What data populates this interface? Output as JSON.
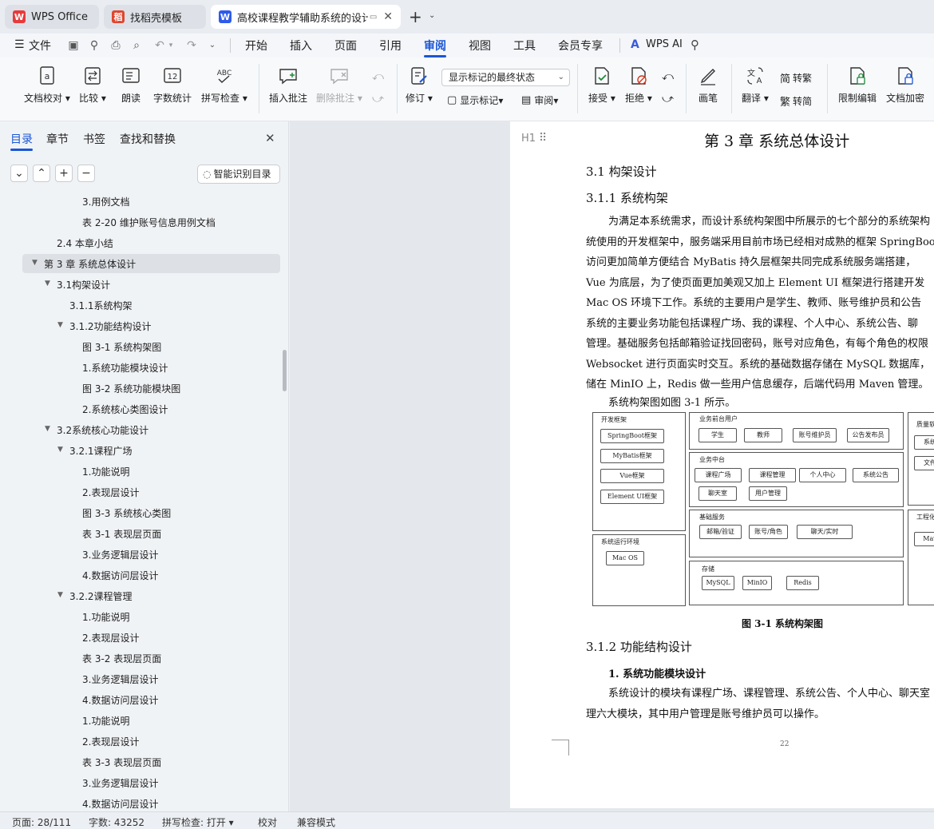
{
  "tabs": [
    {
      "label": "WPS Office",
      "icon": "wps-logo-icon",
      "color": "#e83b3b"
    },
    {
      "label": "找稻壳模板",
      "icon": "docer-icon",
      "color": "#e0462e"
    },
    {
      "label": "高校课程教学辅助系统的设计与",
      "icon": "word-doc-icon",
      "color": "#2f5bea"
    }
  ],
  "menubar": {
    "file": "文件",
    "items": [
      "开始",
      "插入",
      "页面",
      "引用",
      "审阅",
      "视图",
      "工具",
      "会员专享"
    ],
    "active": "审阅",
    "ai": "WPS AI"
  },
  "ribbon": {
    "doc_proof": "文档校对",
    "compare": "比较",
    "read_aloud": "朗读",
    "word_count": "字数统计",
    "spell_check": "拼写检查",
    "insert_comment": "插入批注",
    "delete_comment": "删除批注",
    "revise": "修订",
    "markup_select": "显示标记的最终状态",
    "show_markup": "显示标记",
    "review": "审阅",
    "accept": "接受",
    "reject": "拒绝",
    "pen": "画笔",
    "translate": "翻译",
    "to_traditional": "转繁",
    "to_simplified": "转简",
    "restrict_edit": "限制编辑",
    "doc_encrypt": "文档加密",
    "spell_icon_text": "ABC",
    "count_icon_text": "12"
  },
  "sidebar": {
    "tabs": [
      "目录",
      "章节",
      "书签",
      "查找和替换"
    ],
    "active_tab": "目录",
    "smart_toc": "智能识别目录",
    "toc": [
      {
        "label": "3.用例文档",
        "level": 4
      },
      {
        "label": "表 2-20 维护账号信息用例文档",
        "level": 4
      },
      {
        "label": "2.4 本章小结",
        "level": 2
      },
      {
        "label": "第 3 章 系统总体设计",
        "level": 1,
        "expanded": true,
        "selected": true
      },
      {
        "label": "3.1构架设计",
        "level": 2,
        "expanded": true
      },
      {
        "label": "3.1.1系统构架",
        "level": 3
      },
      {
        "label": "3.1.2功能结构设计",
        "level": 3,
        "expanded": true
      },
      {
        "label": "图 3-1 系统构架图",
        "level": 4
      },
      {
        "label": "1.系统功能模块设计",
        "level": 4
      },
      {
        "label": "图 3-2  系统功能模块图",
        "level": 4
      },
      {
        "label": "2.系统核心类图设计",
        "level": 4
      },
      {
        "label": "3.2系统核心功能设计",
        "level": 2,
        "expanded": true
      },
      {
        "label": "3.2.1课程广场",
        "level": 3,
        "expanded": true
      },
      {
        "label": "1.功能说明",
        "level": 4
      },
      {
        "label": "2.表现层设计",
        "level": 4
      },
      {
        "label": "图 3-3  系统核心类图",
        "level": 4
      },
      {
        "label": "表 3-1  表现层页面",
        "level": 4
      },
      {
        "label": "3.业务逻辑层设计",
        "level": 4
      },
      {
        "label": "4.数据访问层设计",
        "level": 4
      },
      {
        "label": "3.2.2课程管理",
        "level": 3,
        "expanded": true
      },
      {
        "label": "1.功能说明",
        "level": 4
      },
      {
        "label": "2.表现层设计",
        "level": 4
      },
      {
        "label": "表 3-2  表现层页面",
        "level": 4
      },
      {
        "label": "3.业务逻辑层设计",
        "level": 4
      },
      {
        "label": "4.数据访问层设计",
        "level": 4
      },
      {
        "label": "1.功能说明",
        "level": 4
      },
      {
        "label": "2.表现层设计",
        "level": 4
      },
      {
        "label": "表 3-3  表现层页面",
        "level": 4
      },
      {
        "label": "3.业务逻辑层设计",
        "level": 4
      },
      {
        "label": "4.数据访问层设计",
        "level": 4
      }
    ]
  },
  "document": {
    "heading_marker": "H1",
    "chapter_title": "第 3 章    系统总体设计",
    "h_31": "3.1  构架设计",
    "h_311": "3.1.1  系统构架",
    "para_lines": [
      "为满足本系统需求，而设计系统构架图中所展示的七个部分的系统架构",
      "统使用的开发框架中，服务端采用目前市场已经相对成熟的框架  SpringBoot",
      "访问更加简单方便结合  MyBatis 持久层框架共同完成系统服务端搭建，",
      "Vue 为底层，为了使页面更加美观又加上  Element UI 框架进行搭建开发",
      "Mac OS 环境下工作。系统的主要用户是学生、教师、账号维护员和公告",
      "系统的主要业务功能包括课程广场、我的课程、个人中心、系统公告、聊",
      "管理。基础服务包括邮箱验证找回密码，账号对应角色，有每个角色的权限",
      "Websocket 进行页面实时交互。系统的基础数据存储在  MySQL 数据库，",
      "储在 MinIO 上，Redis 做一些用户信息缓存，后端代码用  Maven 管理。"
    ],
    "figure_intro": "系统构架图如图  3-1 所示。",
    "figure_caption": "图 3-1 系统构架图",
    "h_312": "3.1.2  功能结构设计",
    "sub_1": "1.  系统功能模块设计",
    "para2_lines": [
      "系统设计的模块有课程广场、课程管理、系统公告、个人中心、聊天室",
      "理六大模块，其中用户管理是账号维护员可以操作。"
    ],
    "page_number": "22"
  },
  "architecture": {
    "dev_framework": {
      "title": "开发框架",
      "items": [
        "SpringBoot框架",
        "MyBatis框架",
        "Vue框架",
        "Element UI框架"
      ]
    },
    "runtime": {
      "title": "系统运行环境",
      "items": [
        "Mac OS"
      ]
    },
    "front_users": {
      "title": "业务前台用户",
      "items": [
        "学生",
        "教师",
        "账号维护员",
        "公告发布员"
      ]
    },
    "middle": {
      "title": "业务中台",
      "items": [
        "课程广场",
        "课程管理",
        "个人中心",
        "系统公告",
        "聊天室",
        "用户管理"
      ]
    },
    "basic": {
      "title": "基础服务",
      "items": [
        "邮箱/验证",
        "账号/角色",
        "聊天/实时"
      ]
    },
    "storage": {
      "title": "存储",
      "items": [
        "MySQL",
        "MinIO",
        "Redis"
      ]
    },
    "quality": {
      "title": "质量软",
      "items": [
        "系统",
        "文件"
      ]
    },
    "tools": {
      "title": "工程化",
      "items": [
        "Mav"
      ]
    }
  },
  "status": {
    "page": "页面: 28/111",
    "words": "字数: 43252",
    "spell": "拼写检查: 打开",
    "proof": "校对",
    "compat": "兼容模式"
  },
  "colors": {
    "accent": "#1a56d6",
    "wps_red": "#e83b3b"
  }
}
